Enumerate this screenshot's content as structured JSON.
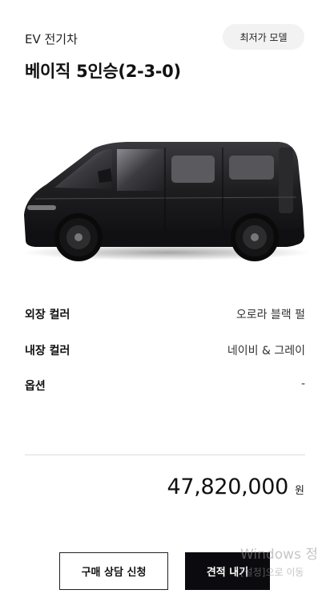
{
  "header": {
    "category": "EV 전기차",
    "badge": "최저가 모델",
    "trim_name": "베이직 5인승(2-3-0)"
  },
  "vehicle_image": {
    "description_icon": "van-side-view-image",
    "body_color": "#1c1c1e"
  },
  "specs": [
    {
      "label": "외장 컬러",
      "value": "오로라 블랙 펄"
    },
    {
      "label": "내장 컬러",
      "value": "네이비 & 그레이"
    },
    {
      "label": "옵션",
      "value": "-"
    }
  ],
  "price": {
    "amount": "47,820,000",
    "currency": "원"
  },
  "actions": {
    "consult_label": "구매 상담 신청",
    "quote_label": "견적 내기"
  },
  "watermark": {
    "line1": "Windows 정",
    "line2": "[설정]으로 이동"
  },
  "colors": {
    "primary_button": "#0b0b0f",
    "badge_bg": "#f2f2f2",
    "divider": "#dddddd"
  }
}
